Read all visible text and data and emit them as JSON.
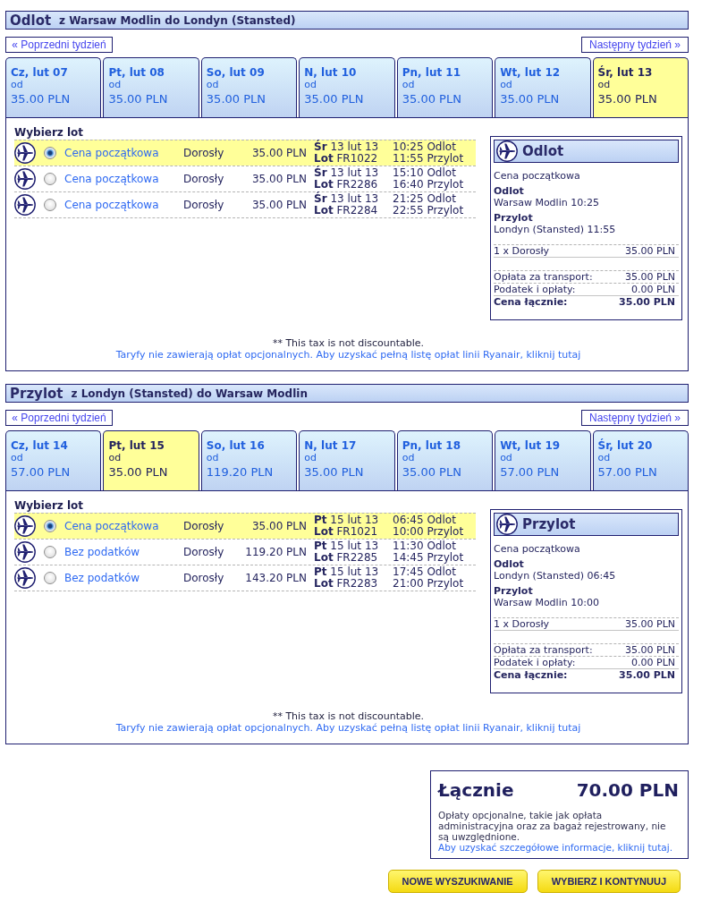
{
  "sections": [
    {
      "title": "Odlot",
      "route": "z Warsaw Modlin do Londyn (Stansted)",
      "prev_week": "« Poprzedni tydzień",
      "next_week": "Następny tydzień »",
      "days": [
        {
          "day": "Cz, lut 07",
          "from": "od",
          "price": "35.00 PLN",
          "selected": false
        },
        {
          "day": "Pt, lut 08",
          "from": "od",
          "price": "35.00 PLN",
          "selected": false
        },
        {
          "day": "So, lut 09",
          "from": "od",
          "price": "35.00 PLN",
          "selected": false
        },
        {
          "day": "N, lut 10",
          "from": "od",
          "price": "35.00 PLN",
          "selected": false
        },
        {
          "day": "Pn, lut 11",
          "from": "od",
          "price": "35.00 PLN",
          "selected": false
        },
        {
          "day": "Wt, lut 12",
          "from": "od",
          "price": "35.00 PLN",
          "selected": false
        },
        {
          "day": "Śr, lut 13",
          "from": "od",
          "price": "35.00 PLN",
          "selected": true
        }
      ],
      "select_label": "Wybierz lot",
      "flights": [
        {
          "fare": "Cena początkowa",
          "passenger": "Dorosły",
          "price": "35.00 PLN",
          "date": "**Śr** 13 lut 13",
          "flight": "**Lot** FR1022",
          "departure": "10:25 Odlot",
          "arrival": "11:55 Przylot",
          "selected": true
        },
        {
          "fare": "Cena początkowa",
          "passenger": "Dorosły",
          "price": "35.00 PLN",
          "date": "**Śr** 13 lut 13",
          "flight": "**Lot** FR2286",
          "departure": "15:10 Odlot",
          "arrival": "16:40 Przylot",
          "selected": false
        },
        {
          "fare": "Cena początkowa",
          "passenger": "Dorosły",
          "price": "35.00 PLN",
          "date": "**Śr** 13 lut 13",
          "flight": "**Lot** FR2284",
          "departure": "21:25 Odlot",
          "arrival": "22:55 Przylot",
          "selected": false
        }
      ],
      "summary": {
        "title": "Odlot",
        "fare": "Cena początkowa",
        "departure": {
          "label": "Odlot",
          "value": "Warsaw Modlin 10:25"
        },
        "arrival": {
          "label": "Przylot",
          "value": "Londyn (Stansted) 11:55"
        },
        "passengers": [
          {
            "label": "1 x Dorosły",
            "amount": "35.00 PLN"
          }
        ],
        "charges": [
          {
            "label": "Opłata za transport:",
            "amount": "35.00 PLN"
          },
          {
            "label": "Podatek i opłaty:",
            "amount": "0.00 PLN"
          }
        ],
        "total": {
          "label": "Cena łącznie:",
          "amount": "35.00 PLN"
        }
      },
      "note": "** This tax is not discountable.",
      "fees_link": "Taryfy nie zawierają opłat opcjonalnych. Aby uzyskać pełną listę opłat linii Ryanair, kliknij tutaj"
    },
    {
      "title": "Przylot",
      "route": "z Londyn (Stansted) do Warsaw Modlin",
      "prev_week": "« Poprzedni tydzień",
      "next_week": "Następny tydzień »",
      "days": [
        {
          "day": "Cz, lut 14",
          "from": "od",
          "price": "57.00 PLN",
          "selected": false
        },
        {
          "day": "Pt, lut 15",
          "from": "od",
          "price": "35.00 PLN",
          "selected": true
        },
        {
          "day": "So, lut 16",
          "from": "od",
          "price": "119.20 PLN",
          "selected": false
        },
        {
          "day": "N, lut 17",
          "from": "od",
          "price": "35.00 PLN",
          "selected": false
        },
        {
          "day": "Pn, lut 18",
          "from": "od",
          "price": "35.00 PLN",
          "selected": false
        },
        {
          "day": "Wt, lut 19",
          "from": "od",
          "price": "57.00 PLN",
          "selected": false
        },
        {
          "day": "Śr, lut 20",
          "from": "od",
          "price": "57.00 PLN",
          "selected": false
        }
      ],
      "select_label": "Wybierz lot",
      "flights": [
        {
          "fare": "Cena początkowa",
          "passenger": "Dorosły",
          "price": "35.00 PLN",
          "date": "**Pt** 15 lut 13",
          "flight": "**Lot** FR1021",
          "departure": "06:45 Odlot",
          "arrival": "10:00 Przylot",
          "selected": true
        },
        {
          "fare": "Bez podatków",
          "passenger": "Dorosły",
          "price": "119.20 PLN",
          "date": "**Pt** 15 lut 13",
          "flight": "**Lot** FR2285",
          "departure": "11:30 Odlot",
          "arrival": "14:45 Przylot",
          "selected": false
        },
        {
          "fare": "Bez podatków",
          "passenger": "Dorosły",
          "price": "143.20 PLN",
          "date": "**Pt** 15 lut 13",
          "flight": "**Lot** FR2283",
          "departure": "17:45 Odlot",
          "arrival": "21:00 Przylot",
          "selected": false
        }
      ],
      "summary": {
        "title": "Przylot",
        "fare": "Cena początkowa",
        "departure": {
          "label": "Odlot",
          "value": "Londyn (Stansted) 06:45"
        },
        "arrival": {
          "label": "Przylot",
          "value": "Warsaw Modlin 10:00"
        },
        "passengers": [
          {
            "label": "1 x Dorosły",
            "amount": "35.00 PLN"
          }
        ],
        "charges": [
          {
            "label": "Opłata za transport:",
            "amount": "35.00 PLN"
          },
          {
            "label": "Podatek i opłaty:",
            "amount": "0.00 PLN"
          }
        ],
        "total": {
          "label": "Cena łącznie:",
          "amount": "35.00 PLN"
        }
      },
      "note": "** This tax is not discountable.",
      "fees_link": "Taryfy nie zawierają opłat opcjonalnych. Aby uzyskać pełną listę opłat linii Ryanair, kliknij tutaj"
    }
  ],
  "total": {
    "label": "Łącznie",
    "amount": "70.00 PLN",
    "note": "Opłaty opcjonalne, takie jak opłata administracyjna oraz za bagaż rejestrowany, nie są uwzględnione.",
    "link": "Aby uzyskać szczegółowe informacje, kliknij tutaj."
  },
  "buttons": [
    {
      "label": "NOWE WYSZUKIWANIE"
    },
    {
      "label": "WYBIERZ I KONTYNUUJ"
    }
  ]
}
